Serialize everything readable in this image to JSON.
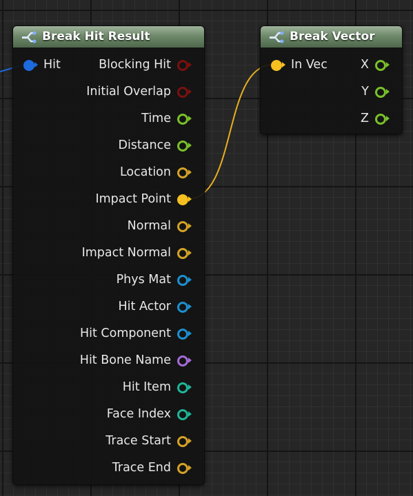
{
  "nodes": {
    "break_hit_result": {
      "title": "Break Hit Result",
      "input": {
        "label": "Hit",
        "color": "#1e6be0"
      },
      "outputs": [
        {
          "label": "Blocking Hit",
          "color": "#7a1010",
          "filled": false
        },
        {
          "label": "Initial Overlap",
          "color": "#7a1010",
          "filled": false
        },
        {
          "label": "Time",
          "color": "#79c02a",
          "filled": false
        },
        {
          "label": "Distance",
          "color": "#79c02a",
          "filled": false
        },
        {
          "label": "Location",
          "color": "#d4a227",
          "filled": false
        },
        {
          "label": "Impact Point",
          "color": "#f5c020",
          "filled": true
        },
        {
          "label": "Normal",
          "color": "#d4a227",
          "filled": false
        },
        {
          "label": "Impact Normal",
          "color": "#d4a227",
          "filled": false
        },
        {
          "label": "Phys Mat",
          "color": "#1e8fd0",
          "filled": false
        },
        {
          "label": "Hit Actor",
          "color": "#1e8fd0",
          "filled": false
        },
        {
          "label": "Hit Component",
          "color": "#1e8fd0",
          "filled": false
        },
        {
          "label": "Hit Bone Name",
          "color": "#a56ad6",
          "filled": false
        },
        {
          "label": "Hit Item",
          "color": "#1fb59a",
          "filled": false
        },
        {
          "label": "Face Index",
          "color": "#1fb59a",
          "filled": false
        },
        {
          "label": "Trace Start",
          "color": "#d4a227",
          "filled": false
        },
        {
          "label": "Trace End",
          "color": "#d4a227",
          "filled": false
        }
      ]
    },
    "break_vector": {
      "title": "Break Vector",
      "input": {
        "label": "In Vec",
        "color": "#f5c020"
      },
      "outputs": [
        {
          "label": "X",
          "color": "#79c02a",
          "filled": false
        },
        {
          "label": "Y",
          "color": "#79c02a",
          "filled": false
        },
        {
          "label": "Z",
          "color": "#79c02a",
          "filled": false
        }
      ]
    }
  },
  "colors": {
    "wire_struct": "#1e6be0",
    "wire_vector": "#e8b020",
    "header_green": "#6f8a6b"
  },
  "icons": {
    "header_icon": "break-struct-icon"
  }
}
